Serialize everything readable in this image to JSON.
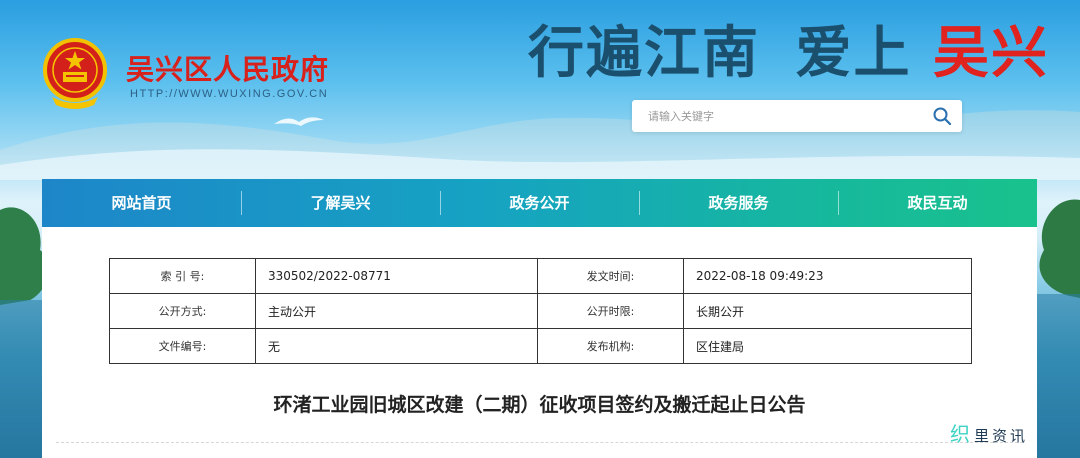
{
  "header": {
    "site_name": "吴兴区人民政府",
    "site_url": "HTTP://WWW.WUXING.GOV.CN",
    "slogan_part1": "行遍江南",
    "slogan_part2": "爱上",
    "slogan_part3": "吴兴"
  },
  "search": {
    "placeholder": "请输入关键字"
  },
  "nav": {
    "items": [
      "网站首页",
      "了解吴兴",
      "政务公开",
      "政务服务",
      "政民互动"
    ]
  },
  "meta": {
    "rows": [
      {
        "label1": "索 引 号:",
        "value1": "330502/2022-08771",
        "label2": "发文时间:",
        "value2": "2022-08-18 09:49:23"
      },
      {
        "label1": "公开方式:",
        "value1": "主动公开",
        "label2": "公开时限:",
        "value2": "长期公开"
      },
      {
        "label1": "文件编号:",
        "value1": "无",
        "label2": "发布机构:",
        "value2": "区住建局"
      }
    ]
  },
  "article": {
    "title": "环渚工业园旧城区改建（二期）征收项目签约及搬迁起止日公告"
  },
  "watermark": {
    "part1": "织",
    "part2": "里资讯"
  },
  "colors": {
    "brand_red": "#d9211c",
    "nav_start": "#1d86c9",
    "nav_end": "#19c28c"
  }
}
